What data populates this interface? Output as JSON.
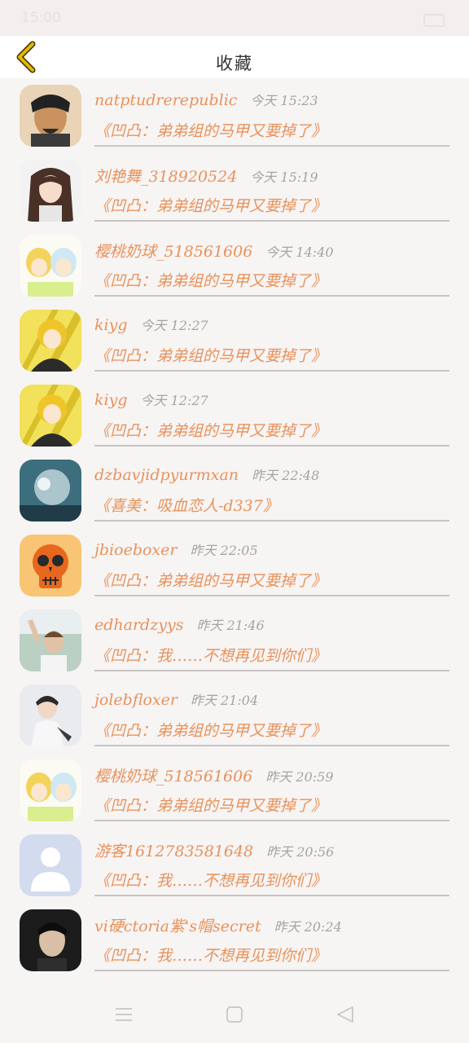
{
  "status_bar": {
    "time": "15:00"
  },
  "header": {
    "title": "收藏",
    "back_icon": "chevron-left-icon",
    "accent": "#e6b800"
  },
  "colors": {
    "name": "#e8925a",
    "time": "#a9a3a3",
    "divider": "#c9c4c4"
  },
  "items": [
    {
      "name": "natptudrerepublic",
      "time": "今天 15:23",
      "favorite": "《凹凸：弟弟组的马甲又要掉了》",
      "avatar": "photo-man-icon"
    },
    {
      "name": "刘艳舞_318920524",
      "time": "今天 15:19",
      "favorite": "《凹凸：弟弟组的马甲又要掉了》",
      "avatar": "anime-girl-icon"
    },
    {
      "name": "樱桃奶球_518561606",
      "time": "今天 14:40",
      "favorite": "《凹凸：弟弟组的马甲又要掉了》",
      "avatar": "anime-duo-icon"
    },
    {
      "name": "kiyg",
      "time": "今天 12:27",
      "favorite": "《凹凸：弟弟组的马甲又要掉了》",
      "avatar": "anime-yellow-icon"
    },
    {
      "name": "kiyg",
      "time": "今天 12:27",
      "favorite": "《凹凸：弟弟组的马甲又要掉了》",
      "avatar": "anime-yellow-icon"
    },
    {
      "name": "dzbavjidpyurmxan",
      "time": "昨天 22:48",
      "favorite": "《喜美：吸血恋人-d337》",
      "avatar": "water-photo-icon"
    },
    {
      "name": "jbioeboxer",
      "time": "昨天 22:05",
      "favorite": "《凹凸：弟弟组的马甲又要掉了》",
      "avatar": "skull-icon"
    },
    {
      "name": "edhardzyys",
      "time": "昨天 21:46",
      "favorite": "《凹凸：我……不想再见到你们》",
      "avatar": "photo-boy-icon"
    },
    {
      "name": "jolebfloxer",
      "time": "昨天 21:04",
      "favorite": "《凹凸：弟弟组的马甲又要掉了》",
      "avatar": "photo-person-icon"
    },
    {
      "name": "樱桃奶球_518561606",
      "time": "昨天 20:59",
      "favorite": "《凹凸：弟弟组的马甲又要掉了》",
      "avatar": "anime-duo-icon"
    },
    {
      "name": "游客1612783581648",
      "time": "昨天 20:56",
      "favorite": "《凹凸：我……不想再见到你们》",
      "avatar": "default-user-icon"
    },
    {
      "name": "vi硬ctoria紫's帽secret",
      "time": "昨天 20:24",
      "favorite": "《凹凸：我……不想再见到你们》",
      "avatar": "photo-man-dark-icon"
    }
  ],
  "navbar": {
    "menu": "menu-icon",
    "home": "home-icon",
    "back": "back-triangle-icon"
  }
}
